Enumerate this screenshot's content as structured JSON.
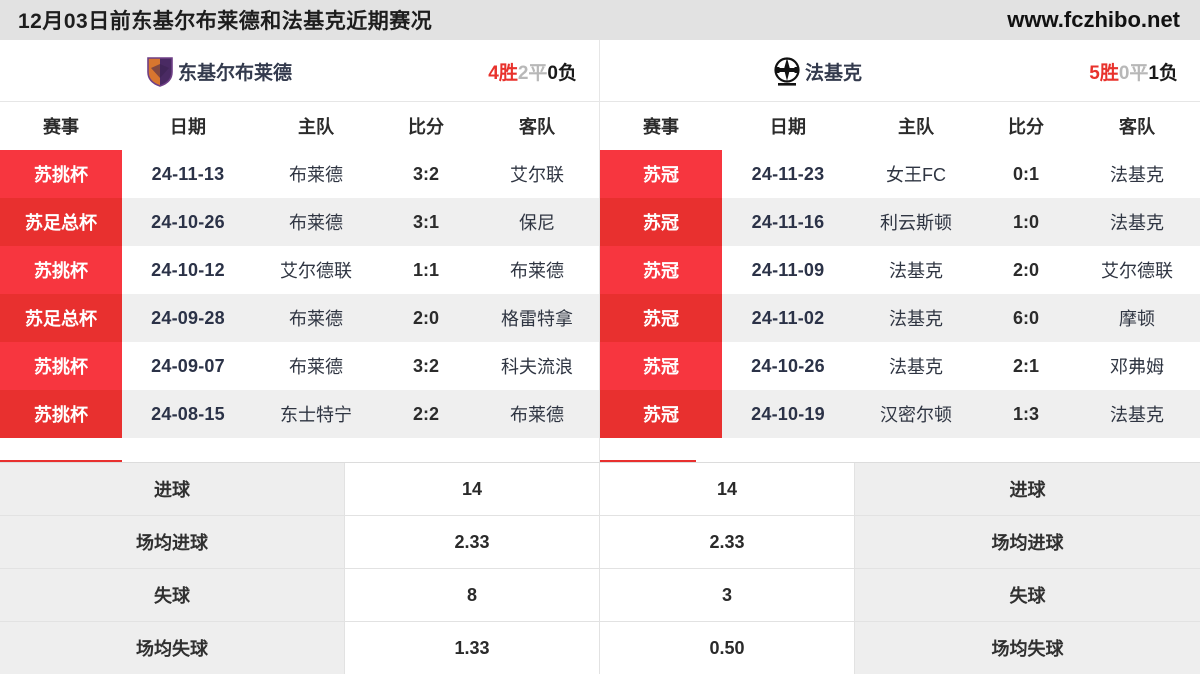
{
  "topbar": {
    "title": "12月03日前东基尔布莱德和法基克近期赛况",
    "site": "www.fczhibo.net"
  },
  "teams": {
    "left": {
      "name": "东基尔布莱德",
      "logo_icon": "shield-crest-icon",
      "logo_colors": [
        "#d8762f",
        "#4a2a63"
      ],
      "record": {
        "wins": "4胜",
        "draws": "2平",
        "losses": "0负"
      }
    },
    "right": {
      "name": "法基克",
      "logo_icon": "circular-crest-icon",
      "logo_colors": [
        "#111111",
        "#ffffff"
      ],
      "record": {
        "wins": "5胜",
        "draws": "0平",
        "losses": "1负"
      }
    }
  },
  "match_table": {
    "columns": [
      "赛事",
      "日期",
      "主队",
      "比分",
      "客队"
    ],
    "left_rows": [
      {
        "comp": "苏挑杯",
        "date": "24-11-13",
        "home": "布莱德",
        "score": "3:2",
        "away": "艾尔联"
      },
      {
        "comp": "苏足总杯",
        "date": "24-10-26",
        "home": "布莱德",
        "score": "3:1",
        "away": "保尼"
      },
      {
        "comp": "苏挑杯",
        "date": "24-10-12",
        "home": "艾尔德联",
        "score": "1:1",
        "away": "布莱德"
      },
      {
        "comp": "苏足总杯",
        "date": "24-09-28",
        "home": "布莱德",
        "score": "2:0",
        "away": "格雷特拿"
      },
      {
        "comp": "苏挑杯",
        "date": "24-09-07",
        "home": "布莱德",
        "score": "3:2",
        "away": "科夫流浪"
      },
      {
        "comp": "苏挑杯",
        "date": "24-08-15",
        "home": "东士特宁",
        "score": "2:2",
        "away": "布莱德"
      }
    ],
    "right_rows": [
      {
        "comp": "苏冠",
        "date": "24-11-23",
        "home": "女王FC",
        "score": "0:1",
        "away": "法基克"
      },
      {
        "comp": "苏冠",
        "date": "24-11-16",
        "home": "利云斯顿",
        "score": "1:0",
        "away": "法基克"
      },
      {
        "comp": "苏冠",
        "date": "24-11-09",
        "home": "法基克",
        "score": "2:0",
        "away": "艾尔德联"
      },
      {
        "comp": "苏冠",
        "date": "24-11-02",
        "home": "法基克",
        "score": "6:0",
        "away": "摩顿"
      },
      {
        "comp": "苏冠",
        "date": "24-10-26",
        "home": "法基克",
        "score": "2:1",
        "away": "邓弗姆"
      },
      {
        "comp": "苏冠",
        "date": "24-10-19",
        "home": "汉密尔顿",
        "score": "1:3",
        "away": "法基克"
      }
    ]
  },
  "stats": {
    "rows": [
      {
        "left_label": "进球",
        "left_value": "14",
        "right_value": "14",
        "right_label": "进球"
      },
      {
        "left_label": "场均进球",
        "left_value": "2.33",
        "right_value": "2.33",
        "right_label": "场均进球"
      },
      {
        "left_label": "失球",
        "left_value": "8",
        "right_value": "3",
        "right_label": "失球"
      },
      {
        "left_label": "场均失球",
        "left_value": "1.33",
        "right_value": "0.50",
        "right_label": "场均失球"
      }
    ]
  },
  "colors": {
    "badge_odd": "#f7363f",
    "badge_even": "#e8302f",
    "accent_red": "#e8322c",
    "topbar_bg": "#e2e2e2",
    "row_even_bg": "#efefef",
    "stat_label_bg": "#eeeeee"
  }
}
